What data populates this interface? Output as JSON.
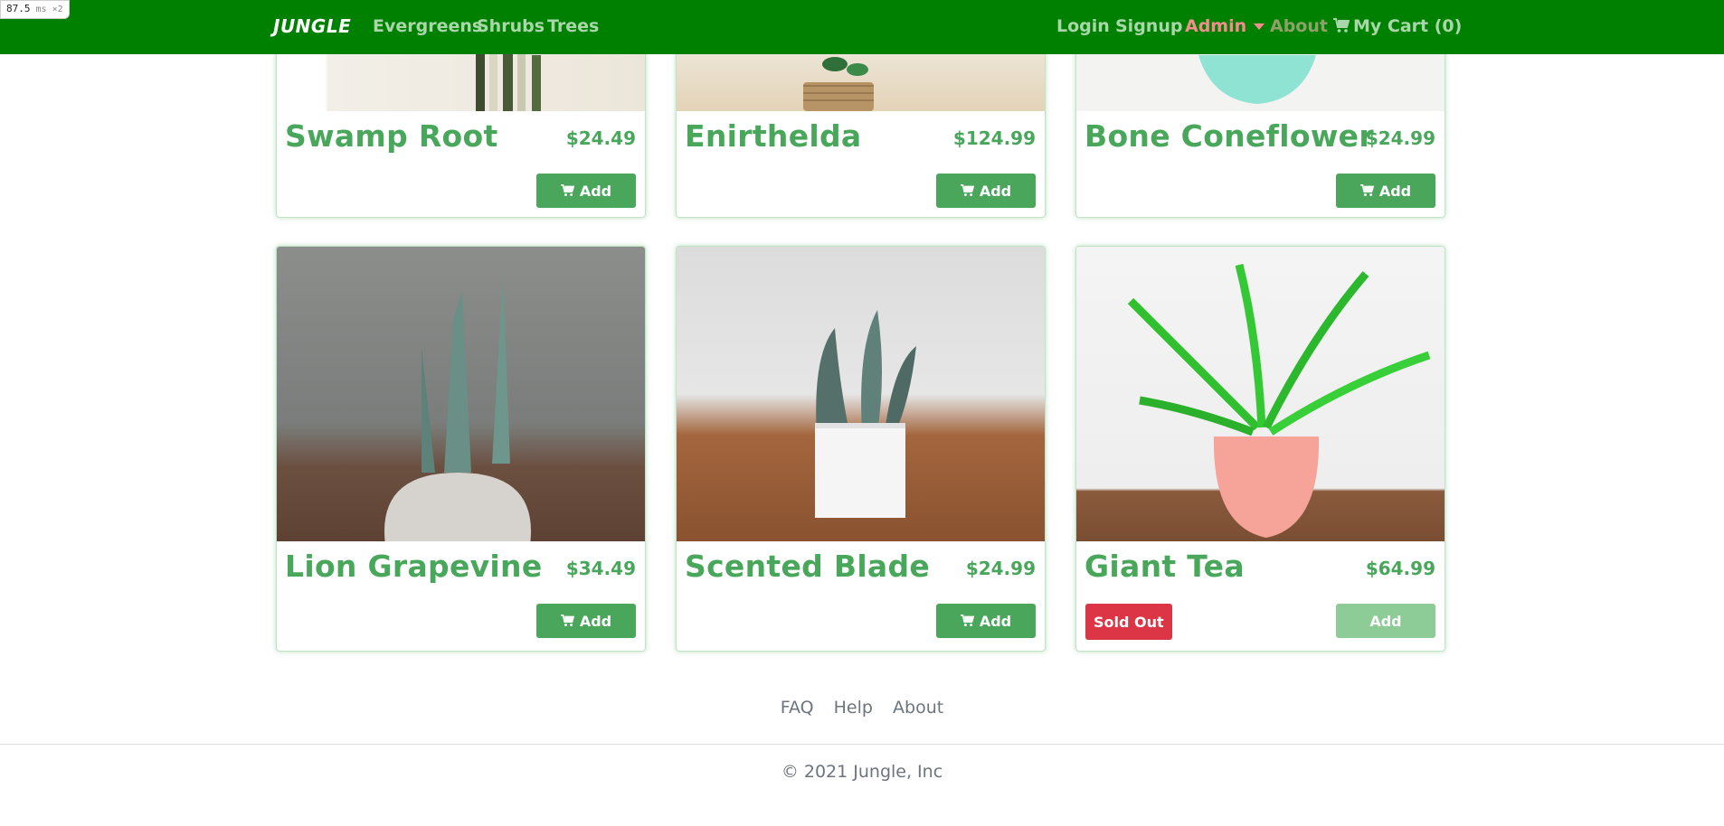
{
  "perf": {
    "value": "87.5",
    "unit": "ms",
    "multiplier": "×2"
  },
  "navbar": {
    "brand": "JUNGLE",
    "categories": [
      "Evergreens",
      "Shrubs",
      "Trees"
    ],
    "login": "Login",
    "signup": "Signup",
    "admin": "Admin",
    "about": "About",
    "cart": "My Cart (0)"
  },
  "products": [
    {
      "name": "Swamp Root",
      "price": "$24.49",
      "add_label": "Add"
    },
    {
      "name": "Enirthelda",
      "price": "$124.99",
      "add_label": "Add"
    },
    {
      "name": "Bone Coneflower",
      "price": "$24.99",
      "add_label": "Add"
    },
    {
      "name": "Lion Grapevine",
      "price": "$34.49",
      "add_label": "Add"
    },
    {
      "name": "Scented Blade",
      "price": "$24.99",
      "add_label": "Add"
    },
    {
      "name": "Giant Tea",
      "price": "$64.99",
      "add_label": "Add",
      "sold_out": "Sold Out"
    }
  ],
  "footer": {
    "links": [
      "FAQ",
      "Help",
      "About"
    ],
    "copyright": "© 2021 Jungle, Inc"
  },
  "colors": {
    "navbar": "#008000",
    "accent": "#48a75a",
    "sold_out": "#dc3545"
  }
}
